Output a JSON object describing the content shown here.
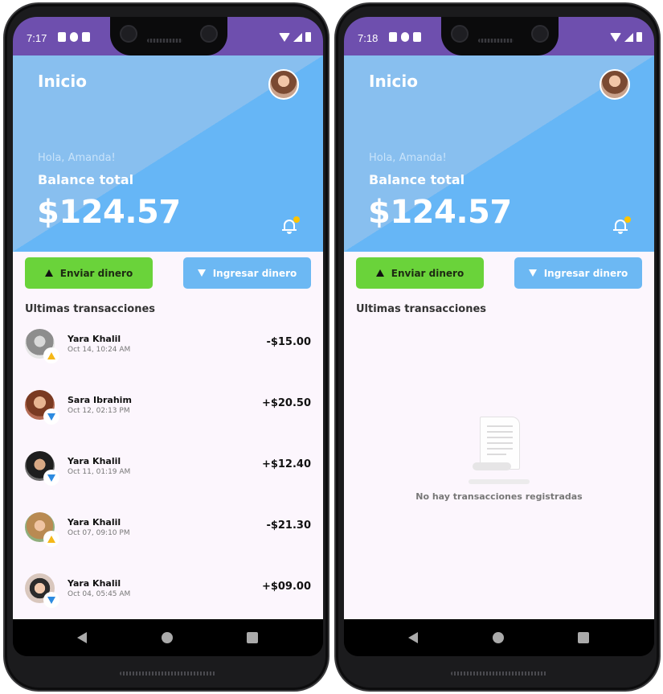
{
  "phones": [
    {
      "status": {
        "time": "7:17"
      },
      "header": {
        "title": "Inicio",
        "greeting": "Hola, Amanda!",
        "balance_label": "Balance total",
        "balance": "$124.57"
      },
      "actions": {
        "send": "Enviar dinero",
        "receive": "Ingresar dinero"
      },
      "section_title": "Ultimas transacciones",
      "transactions": [
        {
          "name": "Yara Khalil",
          "date": "Oct 14, 10:24 AM",
          "amount": "-$15.00",
          "direction": "up"
        },
        {
          "name": "Sara Ibrahim",
          "date": "Oct 12, 02:13 PM",
          "amount": "+$20.50",
          "direction": "down"
        },
        {
          "name": "Yara Khalil",
          "date": "Oct 11, 01:19 AM",
          "amount": "+$12.40",
          "direction": "down"
        },
        {
          "name": "Yara Khalil",
          "date": "Oct 07, 09:10 PM",
          "amount": "-$21.30",
          "direction": "up"
        },
        {
          "name": "Yara Khalil",
          "date": "Oct 04, 05:45 AM",
          "amount": "+$09.00",
          "direction": "down"
        }
      ]
    },
    {
      "status": {
        "time": "7:18"
      },
      "header": {
        "title": "Inicio",
        "greeting": "Hola, Amanda!",
        "balance_label": "Balance total",
        "balance": "$124.57"
      },
      "actions": {
        "send": "Enviar dinero",
        "receive": "Ingresar dinero"
      },
      "section_title": "Ultimas transacciones",
      "empty_message": "No hay transacciones registradas"
    }
  ],
  "colors": {
    "status_bar": "#6e4fae",
    "header": "#66b6f6",
    "send_button": "#6ad33a",
    "receive_button": "#6cb8f3",
    "badge_sent": "#f5b818",
    "badge_received": "#2d8be0",
    "notification_dot": "#ffc400"
  },
  "icons": [
    "bell-icon",
    "arrow-up-icon",
    "arrow-down-icon",
    "receipt-icon",
    "back-icon",
    "home-icon",
    "recents-icon"
  ]
}
